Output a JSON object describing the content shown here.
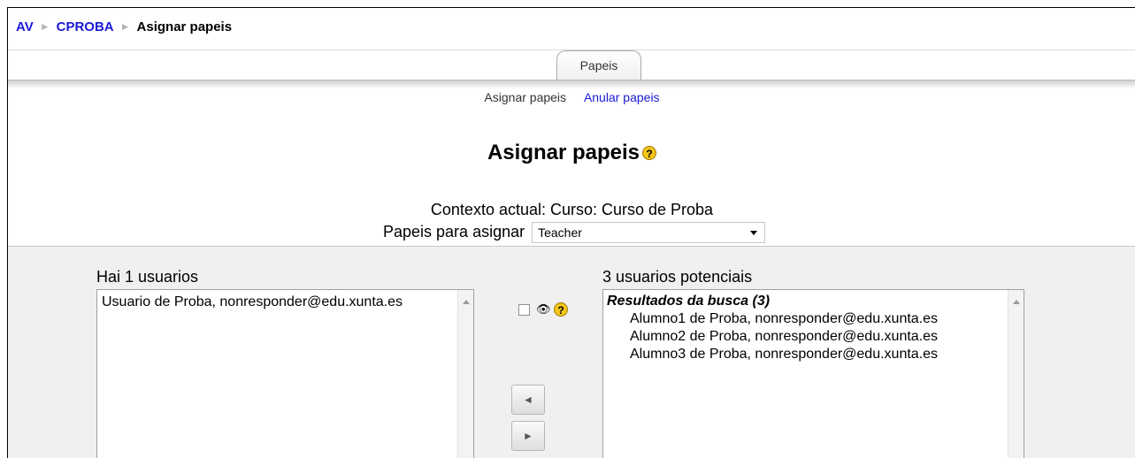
{
  "breadcrumb": {
    "items": [
      "AV",
      "CPROBA"
    ],
    "current": "Asignar papeis",
    "separator": "►"
  },
  "tabs": {
    "active": "Papeis"
  },
  "subtabs": {
    "active": "Asignar papeis",
    "link": "Anular papeis"
  },
  "page": {
    "title": "Asignar papeis",
    "help_glyph": "?",
    "context": "Contexto actual: Curso: Curso de Proba",
    "role_label": "Papeis para asignar",
    "role_selected": "Teacher"
  },
  "existing": {
    "label": "Hai 1 usuarios",
    "options": [
      "Usuario de Proba, nonresponder@edu.xunta.es"
    ]
  },
  "potential": {
    "label": "3 usuarios potenciais",
    "group": "Resultados da busca (3)",
    "options": [
      "Alumno1 de Proba, nonresponder@edu.xunta.es",
      "Alumno2 de Proba, nonresponder@edu.xunta.es",
      "Alumno3 de Proba, nonresponder@edu.xunta.es"
    ]
  },
  "controls": {
    "add_arrow": "◄",
    "remove_arrow": "►",
    "eye_glyph": "👁"
  },
  "icons": [
    "help-icon",
    "eye-icon",
    "dropdown-arrow-icon",
    "scroll-up-icon"
  ],
  "colors": {
    "link": "#1a1ad6",
    "help": "#f5c518",
    "panel": "#f0f0f0"
  }
}
